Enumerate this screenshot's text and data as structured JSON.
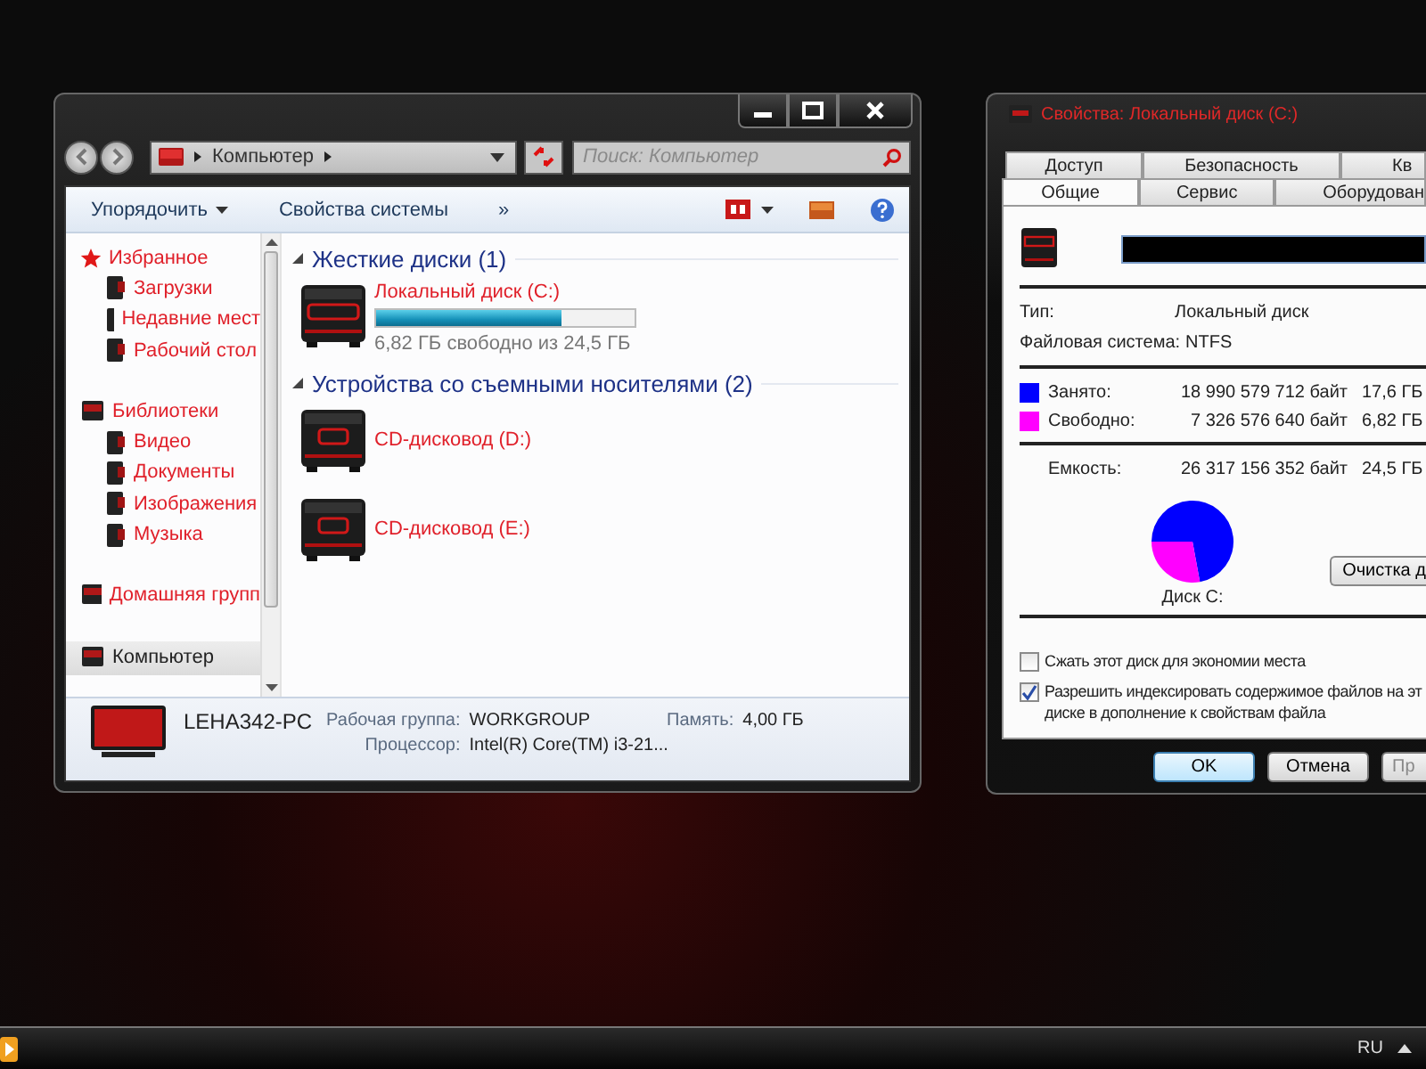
{
  "explorer": {
    "address": {
      "path": "Компьютер"
    },
    "search": {
      "placeholder": "Поиск: Компьютер"
    },
    "toolbar": {
      "buttons": [
        {
          "label": "Упорядочить",
          "kind": "menu"
        },
        {
          "label": "Свойства системы",
          "kind": "action"
        }
      ],
      "more": "»"
    },
    "sidebar": {
      "items": [
        {
          "label": "Избранное",
          "selected": false,
          "children": [
            {
              "label": "Загрузки",
              "selected": false
            },
            {
              "label": "Недавние мест",
              "selected": false
            },
            {
              "label": "Рабочий стол",
              "selected": false
            }
          ]
        },
        {
          "label": "Библиотеки",
          "selected": false,
          "children": [
            {
              "label": "Видео",
              "selected": false
            },
            {
              "label": "Документы",
              "selected": false
            },
            {
              "label": "Изображения",
              "selected": false
            },
            {
              "label": "Музыка",
              "selected": false
            }
          ]
        },
        {
          "label": "Домашняя групп",
          "selected": false
        },
        {
          "label": "Компьютер",
          "selected": true
        }
      ]
    },
    "groups": [
      {
        "title": "Жесткие диски (1)",
        "items": [
          {
            "name": "Локальный диск (C:)",
            "kind": "hdd",
            "level": 0.72,
            "info": "6,82 ГБ свободно из 24,5 ГБ"
          }
        ]
      },
      {
        "title": "Устройства со съемными носителями (2)",
        "items": [
          {
            "name": "CD-дисковод (D:)",
            "kind": "cd"
          },
          {
            "name": "CD-дисковод (E:)",
            "kind": "cd"
          }
        ]
      }
    ],
    "details": {
      "computer_name": "LEHA342-PC",
      "fields": [
        {
          "label": "Рабочая группа:",
          "value": "WORKGROUP"
        },
        {
          "label": "Память:",
          "value": "4,00 ГБ"
        },
        {
          "label": "Процессор:",
          "value": "Intel(R) Core(TM) i3-21..."
        }
      ]
    }
  },
  "properties": {
    "title": "Свойства: Локальный диск (C:)",
    "tabs_back": [
      {
        "label": "Доступ",
        "selected": false
      },
      {
        "label": "Безопасность",
        "selected": false
      },
      {
        "label": "Кв",
        "selected": false
      }
    ],
    "tabs_front": [
      {
        "label": "Общие",
        "selected": true
      },
      {
        "label": "Сервис",
        "selected": false
      },
      {
        "label": "Оборудован",
        "selected": false
      }
    ],
    "info": [
      {
        "label": "Тип:",
        "value": "Локальный диск"
      },
      {
        "label": "Файловая система:",
        "value": "NTFS"
      }
    ],
    "usage": [
      {
        "label": "Занято:",
        "bytes": "18 990 579 712 байт",
        "size": "17,6 ГБ",
        "color": "#0000ff"
      },
      {
        "label": "Свободно:",
        "bytes": "7 326 576 640 байт",
        "size": "6,82 ГБ",
        "color": "#ff00ff"
      }
    ],
    "capacity": {
      "label": "Емкость:",
      "bytes": "26 317 156 352 байт",
      "size": "24,5 ГБ"
    },
    "chart_data": {
      "type": "pie",
      "title": "Диск C:",
      "values": [
        72.1,
        27.9
      ]
    },
    "cleanup_button": "Очистка д",
    "options": [
      {
        "label": "Сжать этот диск для экономии места",
        "checked": false
      },
      {
        "label": "Разрешить индексировать содержимое файлов на эт\nдиске в дополнение к свойствам файла",
        "checked": true
      }
    ],
    "buttons": [
      {
        "label": "OK",
        "selected": true
      },
      {
        "label": "Отмена",
        "selected": false
      },
      {
        "label": "Пр",
        "selected": false
      }
    ]
  },
  "taskbar": {
    "language": "RU"
  }
}
